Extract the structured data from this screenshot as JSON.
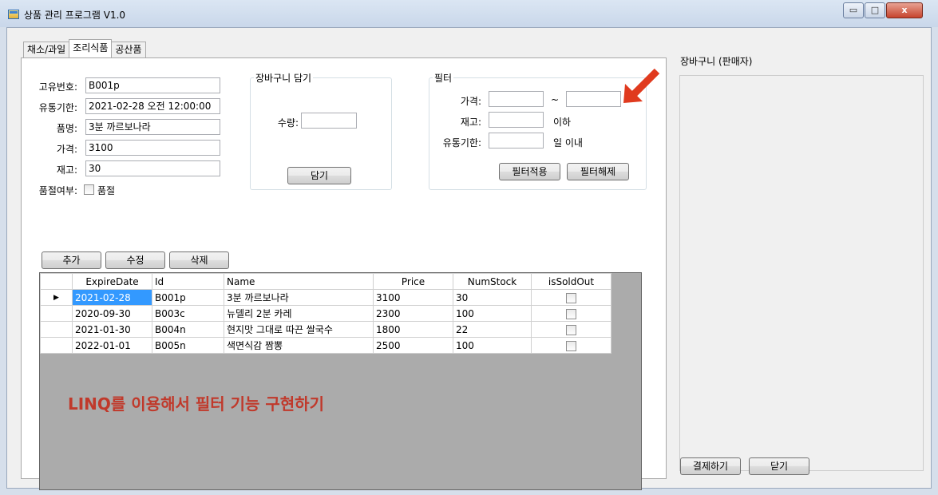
{
  "window": {
    "title": "상품 관리 프로그램 V1.0",
    "controls": {
      "minimize": "▭",
      "maximize": "□",
      "close": "x"
    }
  },
  "tabs": [
    {
      "label": "채소/과일"
    },
    {
      "label": "조리식품"
    },
    {
      "label": "공산품"
    }
  ],
  "product_form": {
    "id_label": "고유번호:",
    "id_value": "B001p",
    "expire_label": "유통기한:",
    "expire_value": "2021-02-28 오전 12:00:00",
    "name_label": "품명:",
    "name_value": "3분 까르보나라",
    "price_label": "가격:",
    "price_value": "3100",
    "stock_label": "재고:",
    "stock_value": "30",
    "soldout_label": "품절여부:",
    "soldout_check_label": "품절"
  },
  "cart_group": {
    "title": "장바구니 담기",
    "qty_label": "수량:",
    "qty_value": "",
    "add_button": "담기"
  },
  "filter_group": {
    "title": "필터",
    "price_label": "가격:",
    "price_from": "",
    "tilde": "~",
    "price_to": "",
    "stock_label": "재고:",
    "stock_value": "",
    "stock_suffix": "이하",
    "expire_label": "유통기한:",
    "expire_value": "",
    "expire_suffix": "일 이내",
    "apply_button": "필터적용",
    "clear_button": "필터해제"
  },
  "actions": {
    "add": "추가",
    "edit": "수정",
    "delete": "삭제"
  },
  "grid": {
    "columns": [
      "ExpireDate",
      "Id",
      "Name",
      "Price",
      "NumStock",
      "isSoldOut"
    ],
    "rows": [
      [
        "2021-02-28",
        "B001p",
        "3분 까르보나라",
        "3100",
        "30",
        false
      ],
      [
        "2020-09-30",
        "B003c",
        "뉴델리 2분 카레",
        "2300",
        "100",
        false
      ],
      [
        "2021-01-30",
        "B004n",
        "현지맛 그대로 따끈 쌀국수",
        "1800",
        "22",
        false
      ],
      [
        "2022-01-01",
        "B005n",
        "색면식감 짬뽕",
        "2500",
        "100",
        false
      ]
    ],
    "current_row_marker": "▶"
  },
  "annotation": {
    "text": "LINQ를 이용해서 필터 기능 구현하기",
    "color": "#c0392b"
  },
  "cart_panel": {
    "title": "장바구니 (판매자)",
    "checkout_button": "결제하기",
    "close_button": "닫기"
  }
}
